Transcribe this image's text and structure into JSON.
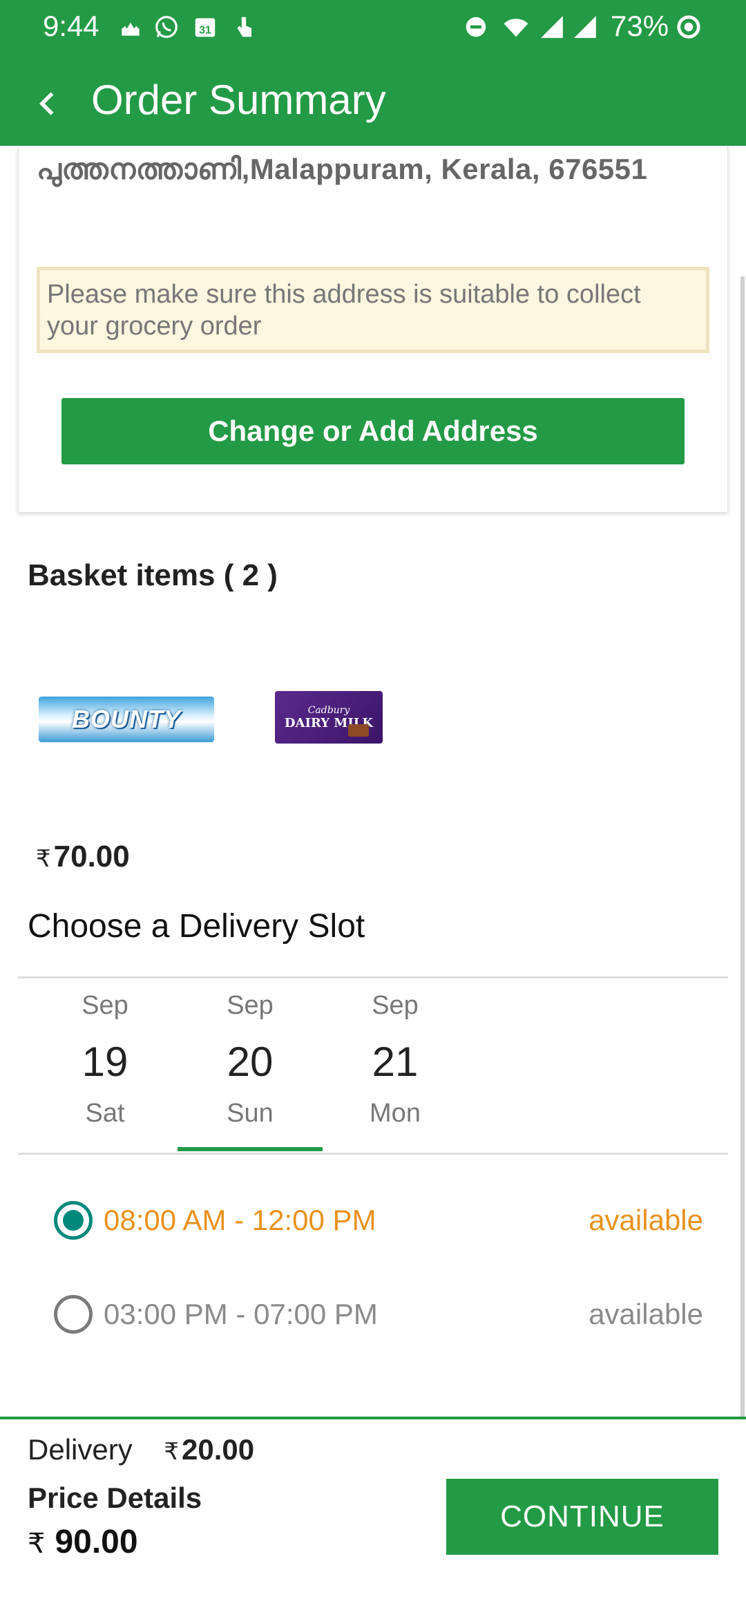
{
  "status_bar": {
    "time": "9:44",
    "calendar_day": "31",
    "battery": "73%"
  },
  "app_bar": {
    "title": "Order Summary"
  },
  "address_card": {
    "address_line": "പുത്തനത്താണി,Malappuram, Kerala, 676551",
    "warning": "Please make sure this address is suitable to collect your grocery order",
    "change_button": "Change or Add Address"
  },
  "basket": {
    "title": "Basket items ( 2 )",
    "items": [
      {
        "name": "BOUNTY"
      },
      {
        "name": "DAIRY MILK",
        "brand": "Cadbury"
      }
    ],
    "currency": "₹",
    "subtotal": "70.00"
  },
  "delivery_slot": {
    "title": "Choose a Delivery Slot",
    "days": [
      {
        "month": "Sep",
        "date": "19",
        "weekday": "Sat"
      },
      {
        "month": "Sep",
        "date": "20",
        "weekday": "Sun"
      },
      {
        "month": "Sep",
        "date": "21",
        "weekday": "Mon"
      }
    ],
    "selected_day_index": 1,
    "slots": [
      {
        "time": "08:00 AM - 12:00 PM",
        "status": "available",
        "selected": true
      },
      {
        "time": "03:00 PM - 07:00 PM",
        "status": "available",
        "selected": false
      }
    ]
  },
  "bottom_bar": {
    "delivery_label": "Delivery",
    "delivery_currency": "₹",
    "delivery_amount": "20.00",
    "price_label": "Price Details",
    "total_currency": "₹",
    "total_amount": "90.00",
    "continue_button": "CONTINUE"
  },
  "colors": {
    "primary": "#239a45",
    "active_slot": "#e8921c",
    "radio_selected": "#00897b",
    "warning_bg": "#fdf6e0"
  }
}
